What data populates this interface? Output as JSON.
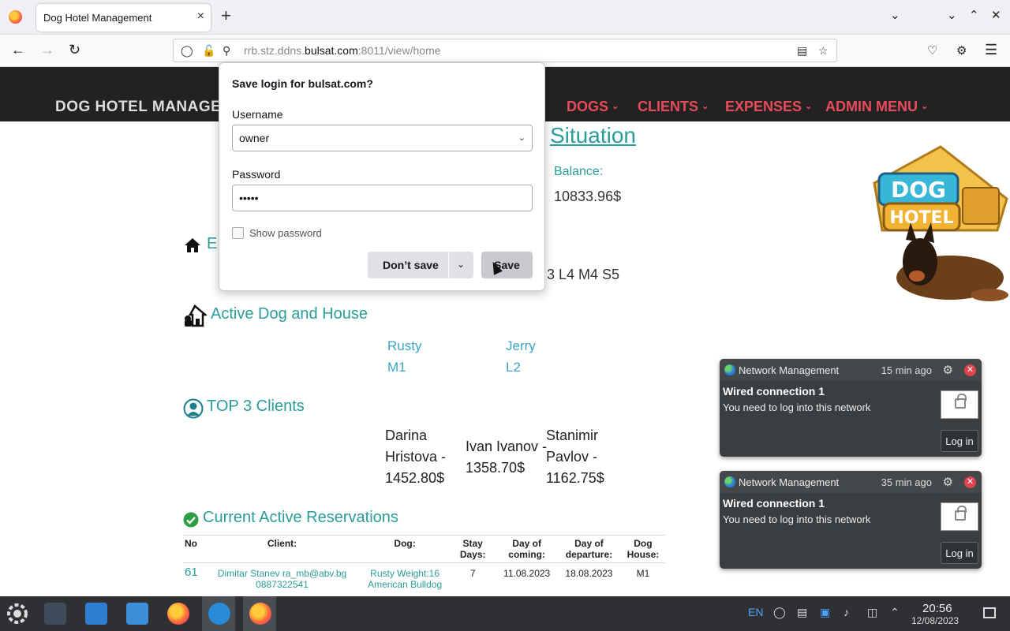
{
  "browser": {
    "tab_title": "Dog Hotel Management",
    "tab_close": "×",
    "new_tab": "+",
    "url_prefix": "rrb.stz.ddns.",
    "url_domain": "bulsat.com",
    "url_suffix": ":8011/view/home",
    "back_icon": "arrow-left-icon",
    "forward_icon": "arrow-right-icon",
    "reload_icon": "reload-icon",
    "window_controls": [
      "⌄",
      "⌄",
      "⌃",
      "✕"
    ]
  },
  "site": {
    "title": "DOG HOTEL MANAGE",
    "menu": [
      "DOGS",
      "CLIENTS",
      "EXPENSES",
      "ADMIN MENU"
    ],
    "caret": "⌄",
    "link_fragment": "Situation",
    "balance_label": "Balance:",
    "balance_value": "10833.96$",
    "houses_tail": "3 L4 M4 S5",
    "empty_houses_fragment": "E",
    "active_dog_title": "Active Dog and House",
    "active_dogs": [
      {
        "name": "Rusty",
        "house": "M1"
      },
      {
        "name": "Jerry",
        "house": "L2"
      }
    ],
    "top_clients_title": "TOP 3 Clients",
    "top_clients": [
      [
        "Darina",
        "Hristova -",
        "1452.80$"
      ],
      [
        "Ivan Ivanov -",
        "1358.70$"
      ],
      [
        "Stanimir",
        "Pavlov -",
        "1162.75$"
      ]
    ],
    "reservations_title": "Current Active Reservations",
    "table_headers": [
      "No",
      "Client:",
      "Dog:",
      "Stay Days:",
      "Day of coming:",
      "Day of departure:",
      "Dog House:"
    ],
    "table_rows": [
      {
        "no": "61",
        "client": "Dimitar Stanev ra_mb@abv.bg 0887322541",
        "dog": "Rusty Weight:16 American Bulldog",
        "stay": "7",
        "coming": "11.08.2023",
        "departure": "18.08.2023",
        "house": "M1"
      }
    ],
    "logo_text_1": "DOG",
    "logo_text_2": "HOTEL"
  },
  "popup": {
    "title": "Save login for bulsat.com?",
    "username_label": "Username",
    "username_value": "owner",
    "password_label": "Password",
    "password_value": "•••••",
    "show_password": "Show password",
    "dont_save": "Don’t save",
    "save": "Save"
  },
  "notifications": [
    {
      "app": "Network Management",
      "time": "15 min ago",
      "title": "Wired connection 1",
      "body": "You need to log into this network",
      "button": "Log in"
    },
    {
      "app": "Network Management",
      "time": "35 min ago",
      "title": "Wired connection 1",
      "body": "You need to log into this network",
      "button": "Log in"
    }
  ],
  "taskbar": {
    "lang": "EN",
    "time": "20:56",
    "date": "12/08/2023"
  },
  "colors": {
    "teal": "#2a9d9a",
    "menu_red": "#e84c5c",
    "header_bg": "#222222"
  }
}
